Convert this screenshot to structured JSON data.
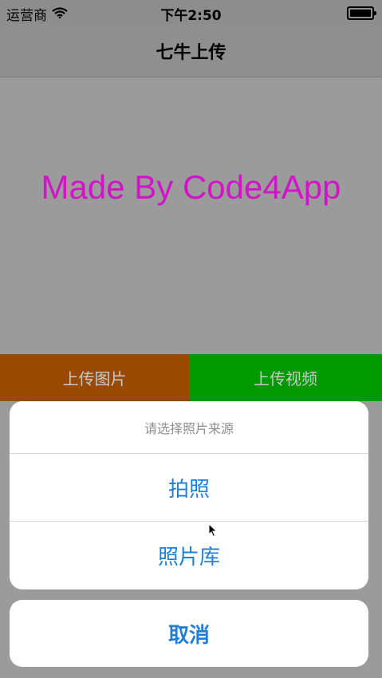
{
  "status": {
    "carrier": "运营商",
    "time": "下午2:50",
    "wifi_icon": "wifi-icon",
    "battery_icon": "battery-icon"
  },
  "nav": {
    "title": "七牛上传"
  },
  "watermark": "Made By Code4App",
  "buttons": {
    "upload_image": "上传图片",
    "upload_video": "上传视频"
  },
  "action_sheet": {
    "title": "请选择照片来源",
    "options": [
      "拍照",
      "照片库"
    ],
    "cancel": "取消"
  },
  "colors": {
    "upload_image_bg": "#9a4a00",
    "upload_video_bg": "#009900",
    "accent": "#1f7fd6",
    "watermark": "#d313c9"
  }
}
